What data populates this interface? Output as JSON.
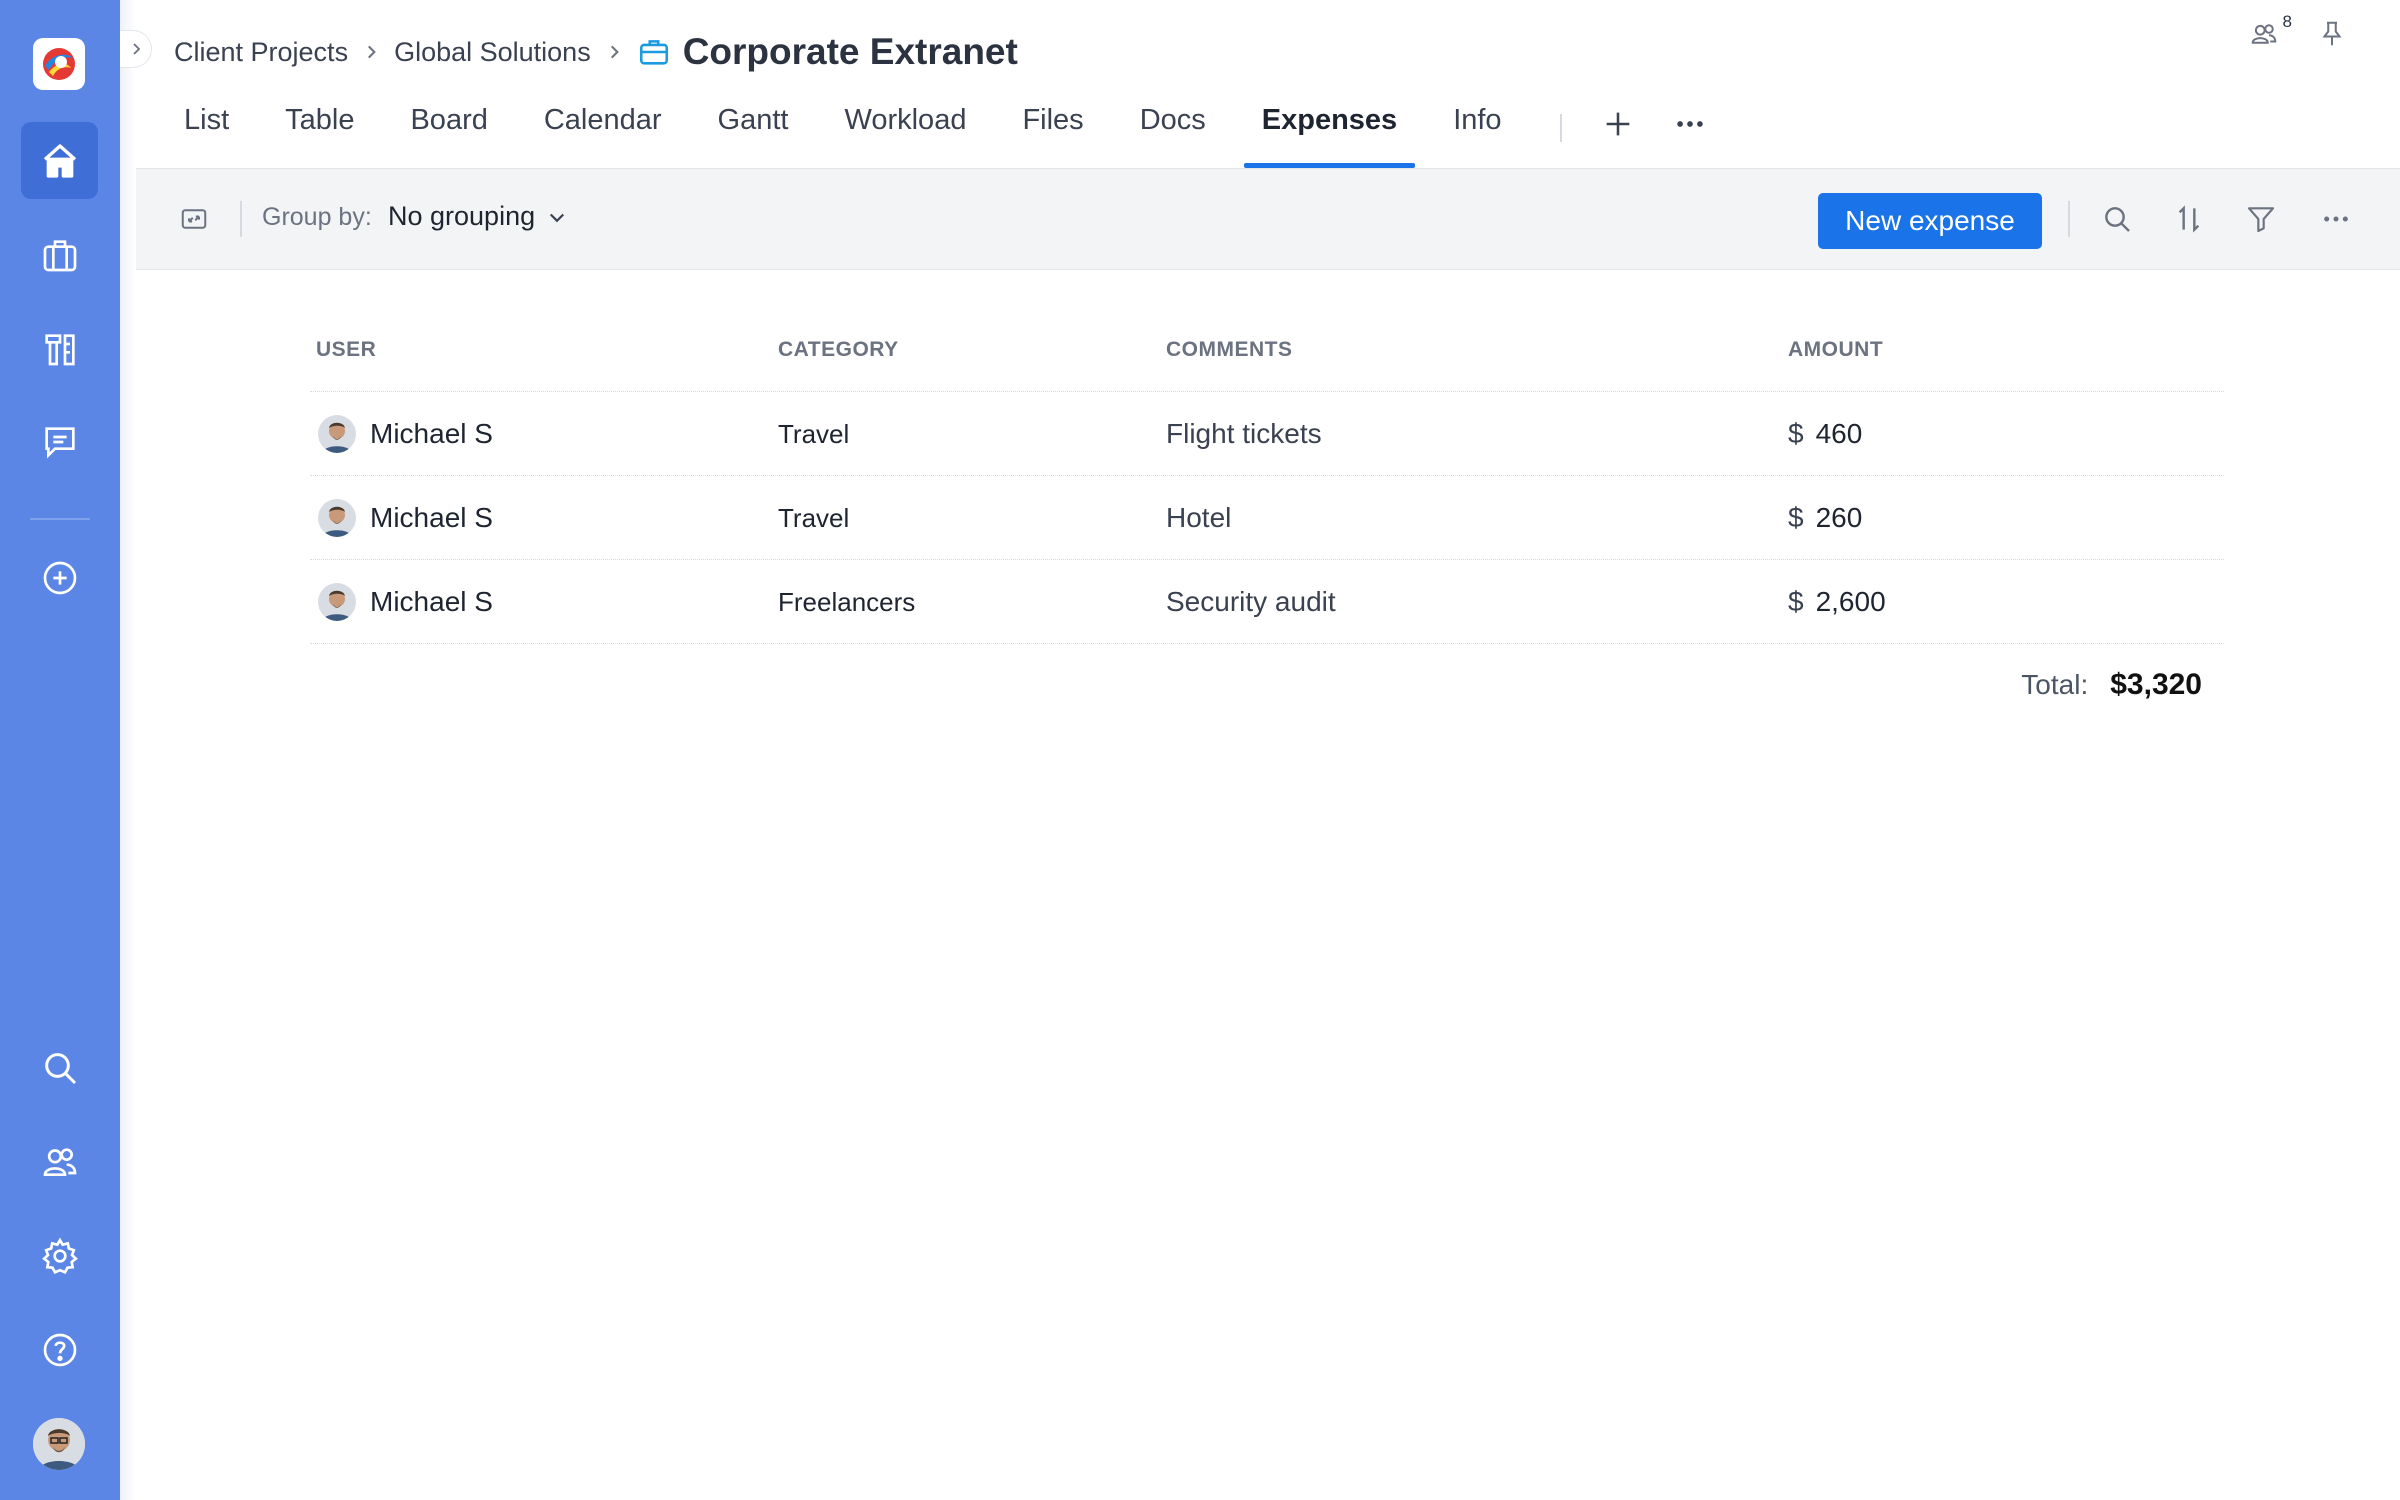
{
  "breadcrumb": {
    "items": [
      "Client Projects",
      "Global Solutions"
    ],
    "title": "Corporate Extranet"
  },
  "header": {
    "members_count": "8"
  },
  "tabs": [
    {
      "label": "List"
    },
    {
      "label": "Table"
    },
    {
      "label": "Board"
    },
    {
      "label": "Calendar"
    },
    {
      "label": "Gantt"
    },
    {
      "label": "Workload"
    },
    {
      "label": "Files"
    },
    {
      "label": "Docs"
    },
    {
      "label": "Expenses",
      "active": true
    },
    {
      "label": "Info"
    }
  ],
  "toolbar": {
    "group_label": "Group by:",
    "group_value": "No grouping",
    "new_expense_label": "New expense"
  },
  "table": {
    "columns": {
      "user": "USER",
      "category": "CATEGORY",
      "comments": "COMMENTS",
      "amount": "AMOUNT"
    },
    "rows": [
      {
        "user": "Michael S",
        "category": "Travel",
        "comments": "Flight tickets",
        "currency": "$",
        "amount": "460"
      },
      {
        "user": "Michael S",
        "category": "Travel",
        "comments": "Hotel",
        "currency": "$",
        "amount": "260"
      },
      {
        "user": "Michael S",
        "category": "Freelancers",
        "comments": "Security audit",
        "currency": "$",
        "amount": "2,600"
      }
    ],
    "total_label": "Total:",
    "total_value": "$3,320"
  },
  "colors": {
    "rail": "#5b86e5",
    "accent": "#1a73e8",
    "toolbar_bg": "#f3f4f6"
  },
  "icons": {
    "rail": [
      "logo",
      "home-icon",
      "briefcase-icon",
      "tools-icon",
      "chat-icon",
      "add-circle-icon",
      "search-icon",
      "users-icon",
      "gear-icon",
      "help-icon",
      "avatar"
    ],
    "toolbar": [
      "expand-icon",
      "chevron-down-icon",
      "search-icon",
      "sort-icon",
      "filter-icon",
      "more-icon"
    ]
  }
}
